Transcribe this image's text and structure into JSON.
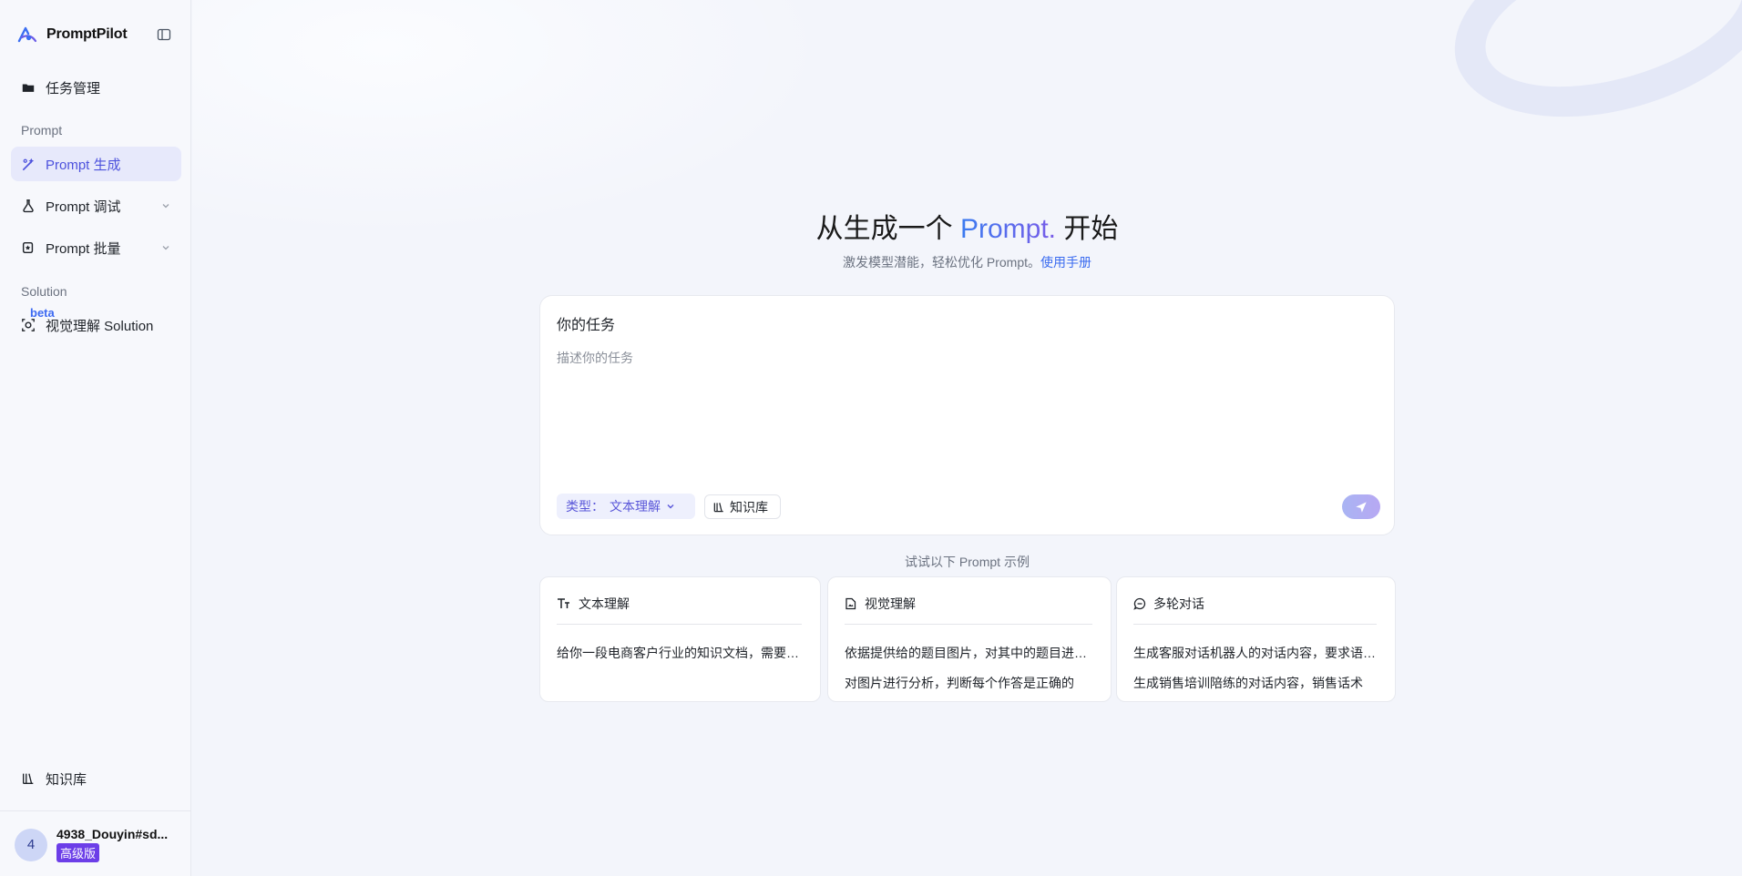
{
  "brand": {
    "name": "PromptPilot"
  },
  "sidebar": {
    "items": [
      {
        "label": "任务管理",
        "icon": "folder-icon"
      },
      {
        "label": "Prompt 生成",
        "icon": "magic-wand-icon",
        "active": true
      },
      {
        "label": "Prompt 调试",
        "icon": "flask-icon",
        "expandable": true
      },
      {
        "label": "Prompt 批量",
        "icon": "stack-icon",
        "expandable": true
      },
      {
        "label": "视觉理解 Solution",
        "icon": "eye-scan-icon"
      },
      {
        "label": "知识库",
        "icon": "library-icon"
      }
    ],
    "sections": {
      "prompt": "Prompt",
      "solution": "Solution"
    },
    "beta": "beta"
  },
  "user": {
    "avatar": "4",
    "name": "4938_Douyin#sd...",
    "plan": "高级版"
  },
  "hero": {
    "title_prefix": "从生成一个 ",
    "title_accent": "Prompt.",
    "title_suffix": " 开始",
    "subtitle": "激发模型潜能，轻松优化 Prompt。",
    "manual_link": "使用手册"
  },
  "task": {
    "title": "你的任务",
    "placeholder": "描述你的任务",
    "type_label": "类型：",
    "type_value": "文本理解",
    "knowledge_label": "知识库"
  },
  "examples": {
    "label": "试试以下 Prompt 示例",
    "cards": [
      {
        "title": "文本理解",
        "icon": "text-icon",
        "line1": "给你一段电商客户行业的知识文档，需要你根据文档回答用户问题",
        "line2": ""
      },
      {
        "title": "视觉理解",
        "icon": "image-doc-icon",
        "line1": "依据提供给的题目图片，对其中的题目进行解答",
        "line2": "对图片进行分析，判断每个作答是正确的"
      },
      {
        "title": "多轮对话",
        "icon": "chat-icon",
        "line1": "生成客服对话机器人的对话内容，要求语气亲切",
        "line2": "生成销售培训陪练的对话内容，销售话术"
      }
    ]
  },
  "colors": {
    "accent": "#4d52dd",
    "link": "#3a6bf0",
    "plan_badge": "#6c3ee8"
  }
}
